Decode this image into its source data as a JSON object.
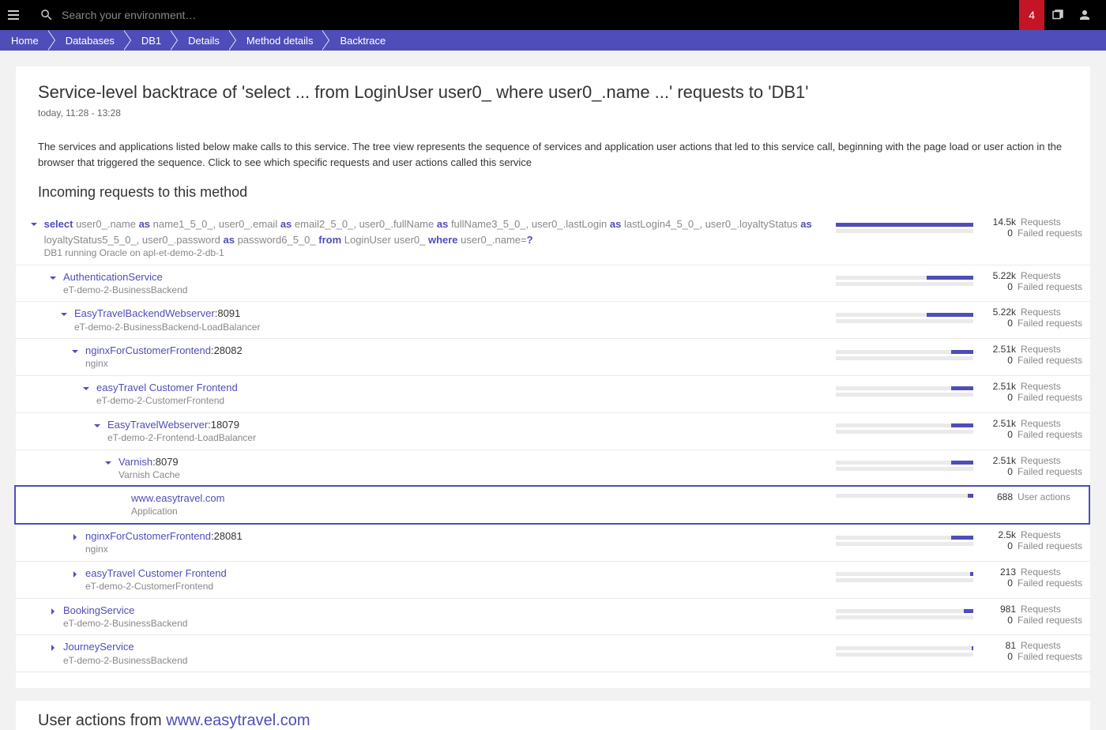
{
  "topbar": {
    "search_placeholder": "Search your environment…",
    "notif_count": "4"
  },
  "breadcrumbs": [
    "Home",
    "Databases",
    "DB1",
    "Details",
    "Method details",
    "Backtrace"
  ],
  "page": {
    "title": "Service-level backtrace of 'select ... from LoginUser user0_ where user0_.name ...' requests to 'DB1'",
    "subtitle": "today, 11:28 - 13:28",
    "description": "The services and applications listed below make calls to this service. The tree view represents the sequence of services and application user actions that led to this service call, beginning with the page load or user action in the browser that triggered the sequence. Click to see which specific requests and user actions called this service",
    "section_title": "Incoming requests to this method"
  },
  "sql": {
    "parts": [
      {
        "t": "kw",
        "v": "select"
      },
      {
        "t": "plain",
        "v": " user0_.name "
      },
      {
        "t": "kw",
        "v": "as"
      },
      {
        "t": "plain",
        "v": " name1_5_0_, user0_.email "
      },
      {
        "t": "kw",
        "v": "as"
      },
      {
        "t": "plain",
        "v": " email2_5_0_, user0_.fullName "
      },
      {
        "t": "kw",
        "v": "as"
      },
      {
        "t": "plain",
        "v": " fullName3_5_0_, user0_.lastLogin "
      },
      {
        "t": "kw",
        "v": "as"
      },
      {
        "t": "plain",
        "v": " lastLogin4_5_0_, user0_.loyaltyStatus "
      },
      {
        "t": "kw",
        "v": "as"
      },
      {
        "t": "plain",
        "v": " loyaltyStatus5_5_0_, user0_.password "
      },
      {
        "t": "kw",
        "v": "as"
      },
      {
        "t": "plain",
        "v": " password6_5_0_ "
      },
      {
        "t": "kw",
        "v": "from"
      },
      {
        "t": "plain",
        "v": " LoginUser user0_ "
      },
      {
        "t": "kw",
        "v": "where"
      },
      {
        "t": "plain",
        "v": " user0_.name="
      },
      {
        "t": "kw",
        "v": "?"
      }
    ],
    "sub": "DB1 running Oracle on apl-et-demo-2-db-1"
  },
  "tree": [
    {
      "indent": 0,
      "chev": "down",
      "title": "",
      "sub": "",
      "sql": true,
      "req": "14.5k",
      "reqlbl": "Requests",
      "fail": "0",
      "faillbl": "Failed requests",
      "bar": 100,
      "highlight": false
    },
    {
      "indent": 1,
      "chev": "down",
      "title": "AuthenticationService",
      "port": "",
      "sub": "eT-demo-2-BusinessBackend",
      "req": "5.22k",
      "reqlbl": "Requests",
      "fail": "0",
      "faillbl": "Failed requests",
      "bar": 34,
      "highlight": false
    },
    {
      "indent": 2,
      "chev": "down",
      "title": "EasyTravelBackendWebserver",
      "port": ":8091",
      "sub": "eT-demo-2-BusinessBackend-LoadBalancer",
      "req": "5.22k",
      "reqlbl": "Requests",
      "fail": "0",
      "faillbl": "Failed requests",
      "bar": 34,
      "highlight": false
    },
    {
      "indent": 3,
      "chev": "down",
      "title": "nginxForCustomerFrontend",
      "port": ":28082",
      "sub": "nginx",
      "req": "2.51k",
      "reqlbl": "Requests",
      "fail": "0",
      "faillbl": "Failed requests",
      "bar": 16,
      "highlight": false
    },
    {
      "indent": 4,
      "chev": "down",
      "title": "easyTravel Customer Frontend",
      "port": "",
      "sub": "eT-demo-2-CustomerFrontend",
      "req": "2.51k",
      "reqlbl": "Requests",
      "fail": "0",
      "faillbl": "Failed requests",
      "bar": 16,
      "highlight": false
    },
    {
      "indent": 5,
      "chev": "down",
      "title": "EasyTravelWebserver",
      "port": ":18079",
      "sub": "eT-demo-2-Frontend-LoadBalancer",
      "req": "2.51k",
      "reqlbl": "Requests",
      "fail": "0",
      "faillbl": "Failed requests",
      "bar": 16,
      "highlight": false
    },
    {
      "indent": 6,
      "chev": "down",
      "title": "Varnish",
      "port": ":8079",
      "sub": "Varnish Cache",
      "req": "2.51k",
      "reqlbl": "Requests",
      "fail": "0",
      "faillbl": "Failed requests",
      "bar": 16,
      "highlight": false
    },
    {
      "indent": 7,
      "chev": "none",
      "title": "www.easytravel.com",
      "port": "",
      "sub": "Application",
      "req": "688",
      "reqlbl": "User actions",
      "fail": "",
      "faillbl": "",
      "bar": 4,
      "highlight": true
    },
    {
      "indent": 3,
      "chev": "right",
      "title": "nginxForCustomerFrontend",
      "port": ":28081",
      "sub": "nginx",
      "req": "2.5k",
      "reqlbl": "Requests",
      "fail": "0",
      "faillbl": "Failed requests",
      "bar": 16,
      "highlight": false
    },
    {
      "indent": 3,
      "chev": "right",
      "title": "easyTravel Customer Frontend",
      "port": "",
      "sub": "eT-demo-2-CustomerFrontend",
      "req": "213",
      "reqlbl": "Requests",
      "fail": "0",
      "faillbl": "Failed requests",
      "bar": 2,
      "highlight": false
    },
    {
      "indent": 1,
      "chev": "right",
      "title": "BookingService",
      "port": "",
      "sub": "eT-demo-2-BusinessBackend",
      "req": "981",
      "reqlbl": "Requests",
      "fail": "0",
      "faillbl": "Failed requests",
      "bar": 7,
      "highlight": false
    },
    {
      "indent": 1,
      "chev": "right",
      "title": "JourneyService",
      "port": "",
      "sub": "eT-demo-2-BusinessBackend",
      "req": "81",
      "reqlbl": "Requests",
      "fail": "0",
      "faillbl": "Failed requests",
      "bar": 1,
      "highlight": false
    }
  ],
  "section2": {
    "prefix": "User actions from ",
    "link": "www.easytravel.com"
  }
}
